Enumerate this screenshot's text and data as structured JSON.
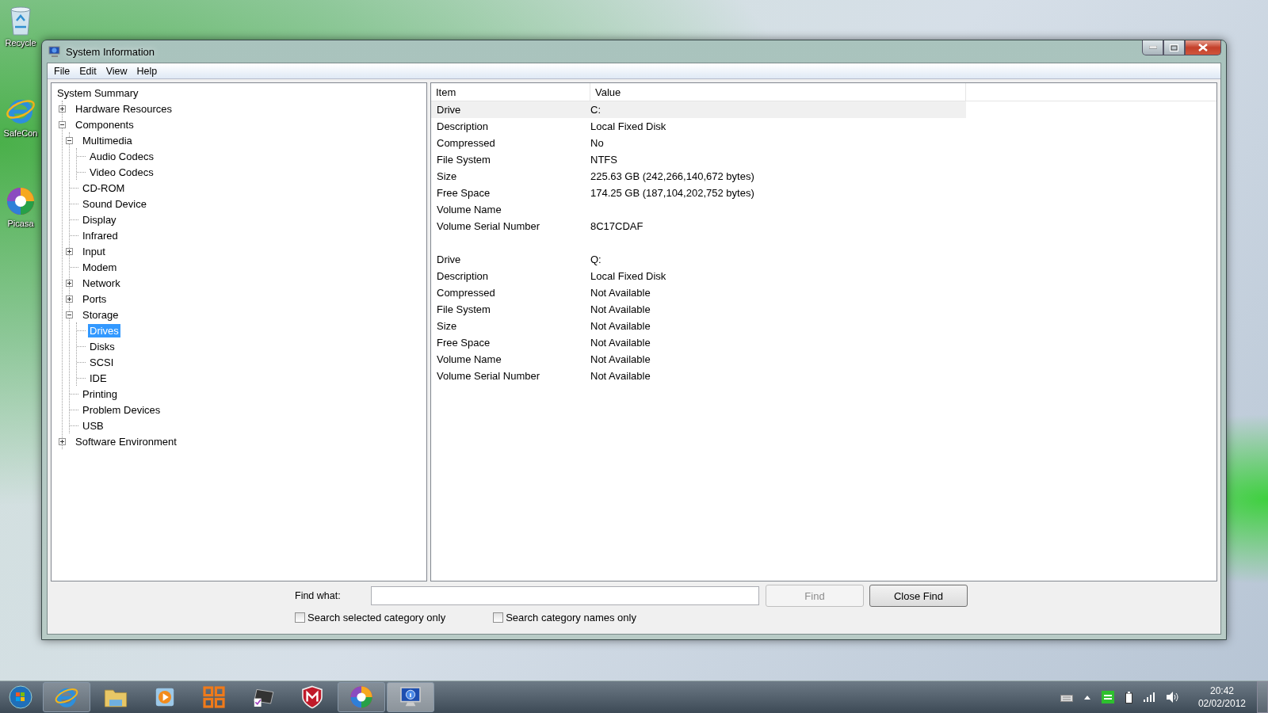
{
  "desktop_icons": [
    {
      "label": "Recycle",
      "kind": "bin"
    },
    {
      "label": "SafeCon",
      "kind": "browser"
    },
    {
      "label": "Picasa",
      "kind": "pinwheel"
    }
  ],
  "window": {
    "title": "System Information"
  },
  "menu": [
    "File",
    "Edit",
    "View",
    "Help"
  ],
  "tree": [
    {
      "label": "System Summary",
      "selected": false,
      "children": [
        {
          "label": "Hardware Resources",
          "selected": false,
          "expanded": false
        },
        {
          "label": "Components",
          "selected": false,
          "expanded": true,
          "children": [
            {
              "label": "Multimedia",
              "selected": false,
              "expanded": true,
              "children": [
                {
                  "label": "Audio Codecs",
                  "selected": false
                },
                {
                  "label": "Video Codecs",
                  "selected": false
                }
              ]
            },
            {
              "label": "CD-ROM",
              "selected": false
            },
            {
              "label": "Sound Device",
              "selected": false
            },
            {
              "label": "Display",
              "selected": false
            },
            {
              "label": "Infrared",
              "selected": false
            },
            {
              "label": "Input",
              "selected": false,
              "expanded": false
            },
            {
              "label": "Modem",
              "selected": false
            },
            {
              "label": "Network",
              "selected": false,
              "expanded": false
            },
            {
              "label": "Ports",
              "selected": false,
              "expanded": false
            },
            {
              "label": "Storage",
              "selected": false,
              "expanded": true,
              "children": [
                {
                  "label": "Drives",
                  "selected": true
                },
                {
                  "label": "Disks",
                  "selected": false
                },
                {
                  "label": "SCSI",
                  "selected": false
                },
                {
                  "label": "IDE",
                  "selected": false
                }
              ]
            },
            {
              "label": "Printing",
              "selected": false
            },
            {
              "label": "Problem Devices",
              "selected": false
            },
            {
              "label": "USB",
              "selected": false
            }
          ]
        },
        {
          "label": "Software Environment",
          "selected": false,
          "expanded": false
        }
      ]
    }
  ],
  "table": {
    "columns": [
      "Item",
      "Value"
    ],
    "groups": [
      {
        "rows": [
          {
            "item": "Drive",
            "value": "C:",
            "selected": true
          },
          {
            "item": "Description",
            "value": "Local Fixed Disk",
            "selected": false
          },
          {
            "item": "Compressed",
            "value": "No",
            "selected": false
          },
          {
            "item": "File System",
            "value": "NTFS",
            "selected": false
          },
          {
            "item": "Size",
            "value": "225.63 GB (242,266,140,672 bytes)",
            "selected": false
          },
          {
            "item": "Free Space",
            "value": "174.25 GB (187,104,202,752 bytes)",
            "selected": false
          },
          {
            "item": "Volume Name",
            "selected": false
          },
          {
            "item": "Volume Serial Number",
            "value": "8C17CDAF",
            "selected": false
          }
        ]
      },
      {
        "rows": [
          {
            "item": "Drive",
            "value": "Q:",
            "selected": false
          },
          {
            "item": "Description",
            "value": "Local Fixed Disk",
            "selected": false
          },
          {
            "item": "Compressed",
            "value": "Not Available",
            "selected": false
          },
          {
            "item": "File System",
            "value": "Not Available",
            "selected": false
          },
          {
            "item": "Size",
            "value": "Not Available",
            "selected": false
          },
          {
            "item": "Free Space",
            "value": "Not Available",
            "selected": false
          },
          {
            "item": "Volume Name",
            "value": "Not Available",
            "selected": false
          },
          {
            "item": "Volume Serial Number",
            "value": "Not Available",
            "selected": false
          }
        ]
      }
    ]
  },
  "find": {
    "label": "Find what:",
    "find_button": {
      "label": "Find",
      "disabled": true
    },
    "close_button": {
      "label": "Close Find",
      "disabled": false
    },
    "options": [
      {
        "label": "Search selected category only",
        "checked": false
      },
      {
        "label": "Search category names only",
        "checked": false
      }
    ]
  },
  "taskbar": {
    "apps": [
      {
        "kind": "browser",
        "running": true,
        "active": false
      },
      {
        "kind": "folder",
        "running": false,
        "active": false
      },
      {
        "kind": "player",
        "running": false,
        "active": false
      },
      {
        "kind": "office",
        "running": false,
        "active": false
      },
      {
        "kind": "laptop",
        "running": false,
        "active": false
      },
      {
        "kind": "shield",
        "running": false,
        "active": false
      },
      {
        "kind": "pinwheel",
        "running": true,
        "active": false
      },
      {
        "kind": "monitor",
        "running": true,
        "active": true
      }
    ],
    "time": "20:42",
    "date": "02/02/2012"
  }
}
